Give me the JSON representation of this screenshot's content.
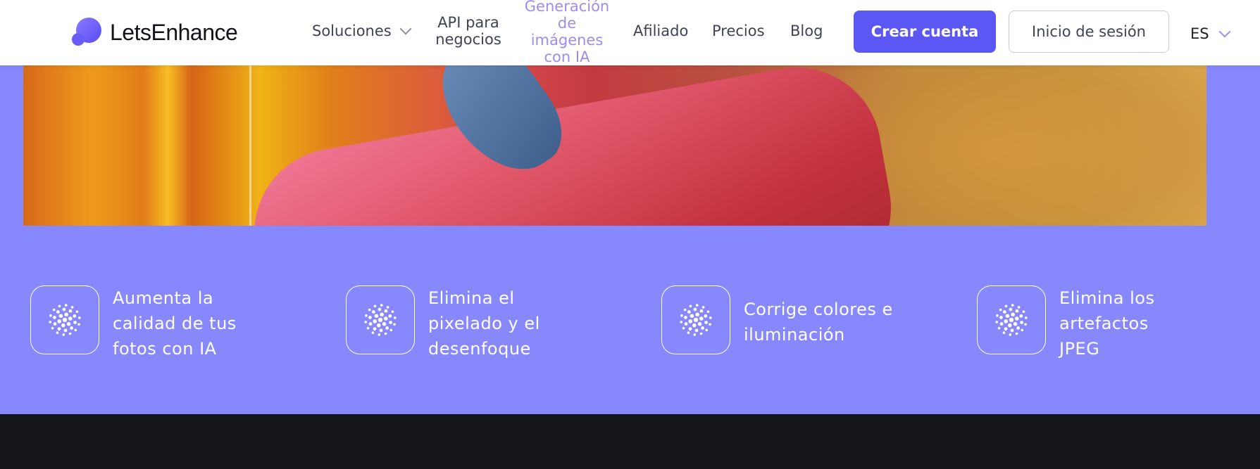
{
  "header": {
    "logo_text": "LetsEnhance",
    "nav": {
      "soluciones": "Soluciones",
      "api": "API para negocios",
      "generacion": "Generación de imágenes con IA",
      "afiliado": "Afiliado",
      "precios": "Precios",
      "blog": "Blog"
    },
    "create_account": "Crear cuenta",
    "login": "Inicio de sesión",
    "language": "ES"
  },
  "features": [
    {
      "text": "Aumenta la calidad de tus fotos con IA",
      "icon": "dots-sparkle-icon"
    },
    {
      "text": "Elimina el pixelado y el desenfoque",
      "icon": "dots-sparkle-icon"
    },
    {
      "text": "Corrige colores e iluminación",
      "icon": "dots-sparkle-icon"
    },
    {
      "text": "Elimina los artefactos JPEG",
      "icon": "dots-sparkle-icon"
    }
  ],
  "colors": {
    "accent": "#5b57f5",
    "band": "#8788fb",
    "dark": "#15161b",
    "active_nav": "#9c8cf0"
  }
}
